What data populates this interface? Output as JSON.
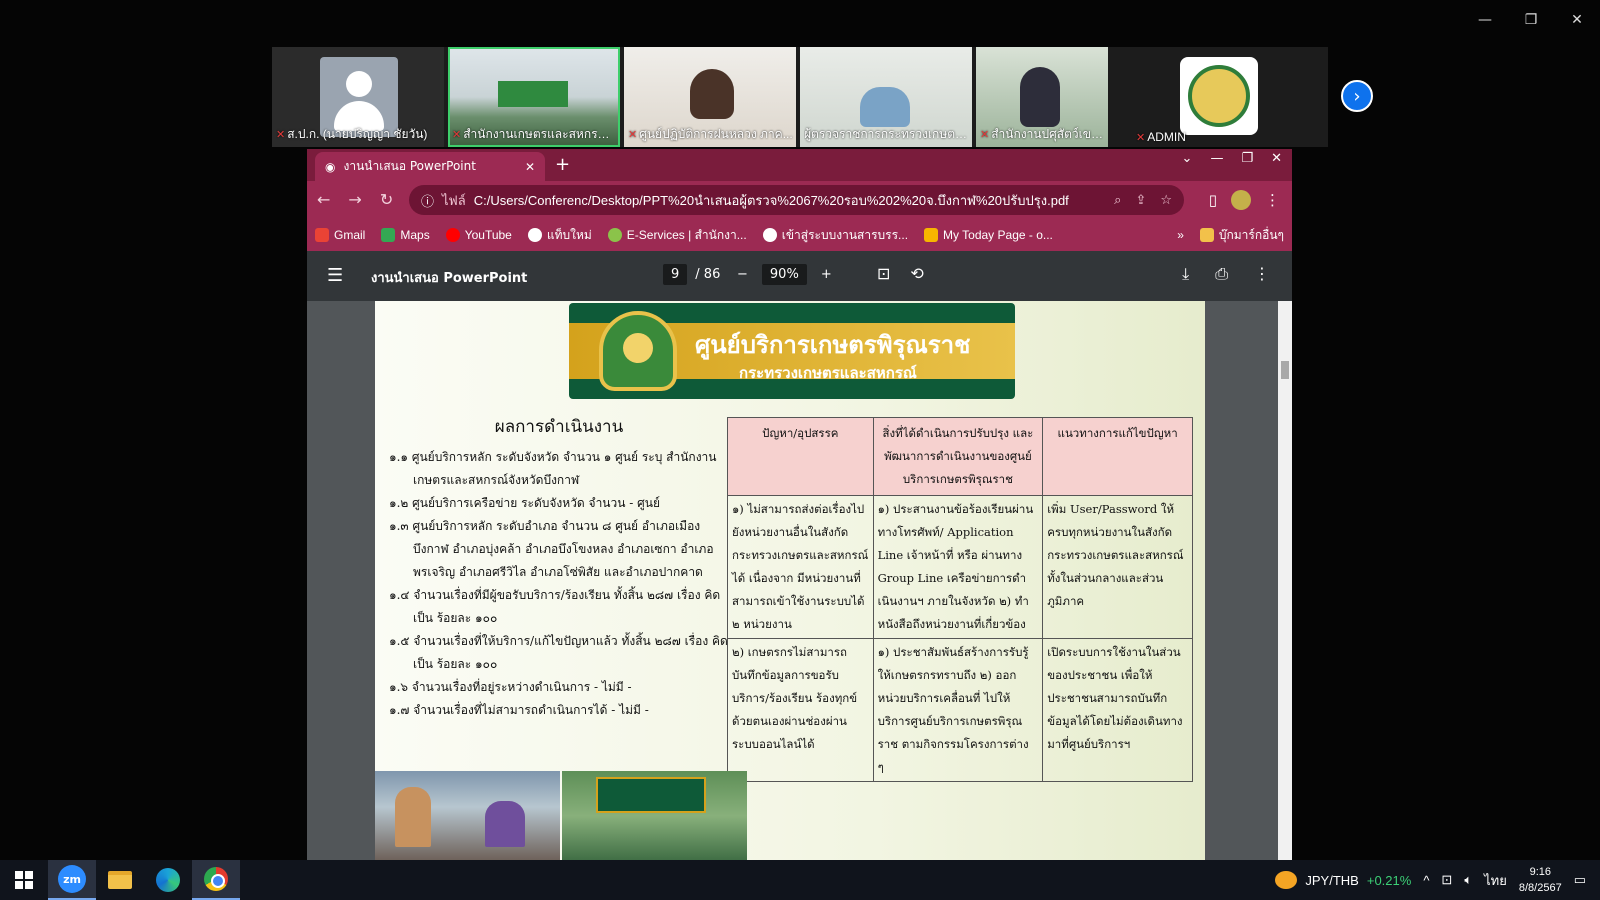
{
  "window": {
    "minimize": "—",
    "restore": "❐",
    "close": "✕"
  },
  "participants": [
    {
      "name": "ส.ป.ก. (นายปริญญา ชัยวัน)",
      "muted": true
    },
    {
      "name": "สำนักงานเกษตรและสหกรณ์จังห...",
      "muted": true
    },
    {
      "name": "ศูนย์ปฏิบัติการฝนหลวง ภาค...",
      "muted": true
    },
    {
      "name": "ผู้ตรวจราชการกระทรวงเกษตรแล...",
      "muted": false
    },
    {
      "name": "สำนักงานปศุสัตว์เขต 4",
      "muted": true
    },
    {
      "name": "ADMIN",
      "muted": true
    }
  ],
  "browser": {
    "tab_title": "งานนำเสนอ PowerPoint",
    "tab_close": "✕",
    "new_tab": "+",
    "address_scheme": "ไฟล์",
    "address": "C:/Users/Conferenc/Desktop/PPT%20นำเสนอผู้ตรวจ%2067%20รอบ%202%20จ.บึงกาฬ%20ปรับปรุง.pdf",
    "bookmarks": [
      {
        "label": "Gmail",
        "color": "#ea4335"
      },
      {
        "label": "Maps",
        "color": "#34a853"
      },
      {
        "label": "YouTube",
        "color": "#ff0000"
      },
      {
        "label": "แท็บใหม่",
        "color": "#ffffff"
      },
      {
        "label": "E-Services | สำนักงา...",
        "color": "#8bc34a"
      },
      {
        "label": "เข้าสู่ระบบงานสารบรร...",
        "color": "#ffffff"
      },
      {
        "label": "My Today Page - o...",
        "color": "#f7b500"
      }
    ],
    "bookmarks_more": "»",
    "bookmarks_folder": "บุ๊กมาร์กอื่นๆ"
  },
  "pdf": {
    "title": "งานนำเสนอ PowerPoint",
    "current_page": "9",
    "total_pages": "/ 86",
    "zoom": "90%",
    "banner_title": "ศูนย์บริการเกษตรพิรุณราช",
    "banner_subtitle": "กระทรวงเกษตรและสหกรณ์",
    "results_heading": "ผลการดำเนินงาน",
    "results_items": [
      "๑.๑ ศูนย์บริการหลัก ระดับจังหวัด จำนวน ๑ ศูนย์ ระบุ สำนักงานเกษตรและสหกรณ์จังหวัดบึงกาฬ",
      "๑.๒ ศูนย์บริการเครือข่าย ระดับจังหวัด จำนวน - ศูนย์",
      "๑.๓ ศูนย์บริการหลัก ระดับอำเภอ จำนวน ๘ ศูนย์ อำเภอเมืองบึงกาฬ อำเภอบุ่งคล้า อำเภอบึงโขงหลง อำเภอเซกา อำเภอพรเจริญ อำเภอศรีวิไล อำเภอโซ่พิสัย และอำเภอปากคาด",
      "๑.๔ จำนวนเรื่องที่มีผู้ขอรับบริการ/ร้องเรียน ทั้งสิ้น ๒๘๗ เรื่อง คิดเป็น ร้อยละ ๑๐๐",
      "๑.๕ จำนวนเรื่องที่ให้บริการ/แก้ไขปัญหาแล้ว ทั้งสิ้น ๒๘๗ เรื่อง คิดเป็น ร้อยละ ๑๐๐",
      "๑.๖ จำนวนเรื่องที่อยู่ระหว่างดำเนินการ - ไม่มี -",
      "๑.๗ จำนวนเรื่องที่ไม่สามารถดำเนินการได้ - ไม่มี -"
    ],
    "table": {
      "headers": [
        "ปัญหา/อุปสรรค",
        "สิ่งที่ได้ดำเนินการปรับปรุง และพัฒนาการดำเนินงานของศูนย์บริการเกษตรพิรุณราช",
        "แนวทางการแก้ไขปัญหา"
      ],
      "rows": [
        [
          "๑) ไม่สามารถส่งต่อเรื่องไปยังหน่วยงานอื่นในสังกัดกระทรวงเกษตรและสหกรณ์ได้ เนื่องจาก มีหน่วยงานที่สามารถเข้าใช้งานระบบได้ ๒ หน่วยงาน",
          "๑) ประสานงานข้อร้องเรียนผ่านทางโทรศัพท์/ Application Line เจ้าหน้าที่ หรือ ผ่านทาง Group Line เครือข่ายการดำเนินงานฯ ภายในจังหวัด ๒) ทำหนังสือถึงหน่วยงานที่เกี่ยวข้อง",
          "เพิ่ม User/Password ให้ครบทุกหน่วยงานในสังกัดกระทรวงเกษตรและสหกรณ์ทั้งในส่วนกลางและส่วนภูมิภาค"
        ],
        [
          "๒) เกษตรกรไม่สามารถบันทึกข้อมูลการขอรับบริการ/ร้องเรียน ร้องทุกข์ด้วยตนเองผ่านช่องผ่านระบบออนไลน์ได้",
          "๑) ประชาสัมพันธ์สร้างการรับรู้ให้เกษตรกรทราบถึง ๒) ออกหน่วยบริการเคลื่อนที่ ไปให้บริการศูนย์บริการเกษตรพิรุณราช ตามกิจกรรมโครงการต่าง ๆ",
          "เปิดระบบการใช้งานในส่วนของประชาชน เพื่อให้ประชาชนสามารถบันทึกข้อมูลได้โดยไม่ต้องเดินทางมาที่ศูนย์บริการฯ"
        ]
      ]
    }
  },
  "taskbar": {
    "zoom_label": "zm",
    "ticker_pair": "JPY/THB",
    "ticker_change": "+0.21%",
    "ime": "ไทย",
    "time": "9:16",
    "date": "8/8/2567"
  }
}
